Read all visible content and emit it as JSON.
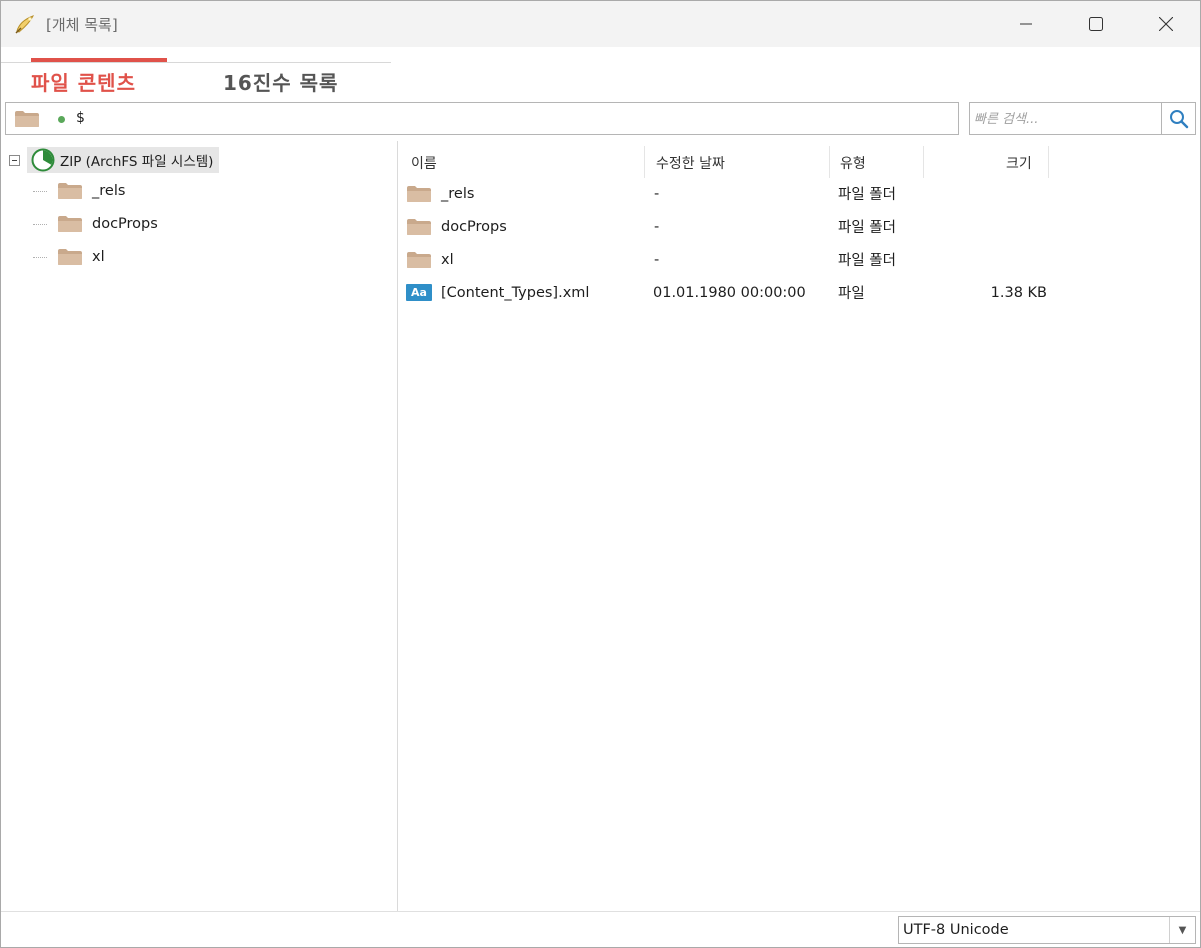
{
  "window": {
    "title": "[개체 목록]"
  },
  "tabs": [
    {
      "label": "파일 콘텐츠",
      "active": true
    },
    {
      "label": "16진수 목록",
      "active": false
    }
  ],
  "pathbar": {
    "path": "$"
  },
  "search": {
    "placeholder": "빠른 검색..."
  },
  "tree": {
    "root": "ZIP (ArchFS 파일 시스템)",
    "children": [
      "_rels",
      "docProps",
      "xl"
    ]
  },
  "list": {
    "columns": {
      "name": "이름",
      "modified": "수정한 날짜",
      "type": "유형",
      "size": "크기"
    },
    "rows": [
      {
        "icon": "folder-icon",
        "name": "_rels",
        "modified": "-",
        "type": "파일 폴더",
        "size": ""
      },
      {
        "icon": "folder-icon",
        "name": "docProps",
        "modified": "-",
        "type": "파일 폴더",
        "size": ""
      },
      {
        "icon": "folder-icon",
        "name": "xl",
        "modified": "-",
        "type": "파일 폴더",
        "size": ""
      },
      {
        "icon": "text-file-icon",
        "icon_text": "Aa",
        "name": "[Content_Types].xml",
        "modified": "01.01.1980 00:00:00",
        "type": "파일",
        "size": "1.38 KB"
      }
    ]
  },
  "status": {
    "encoding": "UTF-8 Unicode"
  },
  "colors": {
    "accent": "#e0524a",
    "folder": "#c9a98c",
    "xml_icon": "#2f8fc8"
  }
}
